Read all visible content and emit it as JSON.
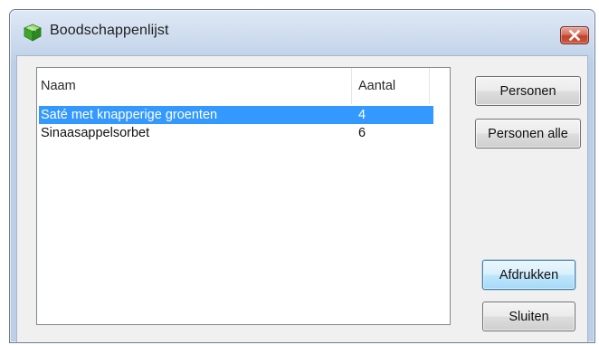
{
  "window": {
    "title": "Boodschappenlijst",
    "icon": "green-box-icon",
    "close_icon": "close-icon"
  },
  "list": {
    "columns": [
      "Naam",
      "Aantal"
    ],
    "rows": [
      {
        "naam": "Saté met knapperige groenten",
        "aantal": "4",
        "selected": true
      },
      {
        "naam": "Sinaasappelsorbet",
        "aantal": "6",
        "selected": false
      }
    ]
  },
  "buttons": {
    "personen": "Personen",
    "personen_alle": "Personen alle",
    "afdrukken": "Afdrukken",
    "sluiten": "Sluiten"
  },
  "colors": {
    "selection": "#3399ff",
    "close_button": "#c2402a",
    "titlebar": "#c9d8ec"
  }
}
